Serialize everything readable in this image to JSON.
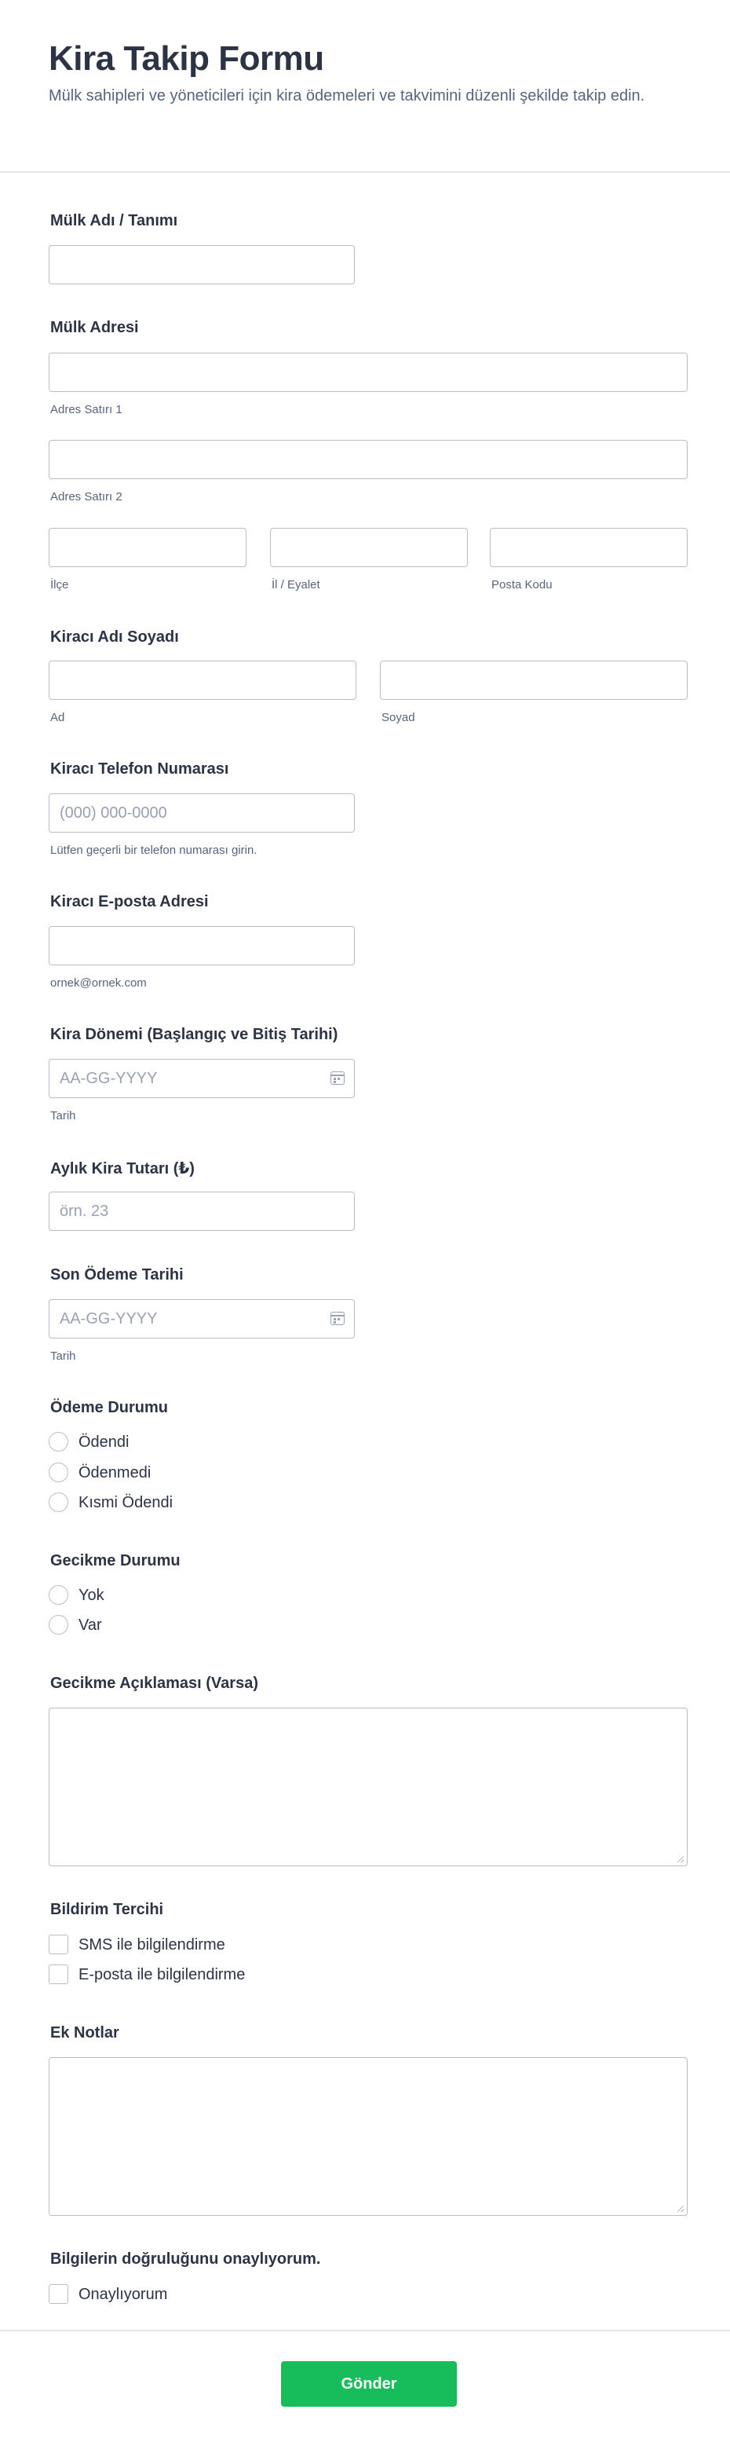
{
  "form": {
    "title": "Kira Takip Formu",
    "subtitle": "Mülk sahipleri ve yöneticileri için kira ödemeleri ve takvimini düzenli şekilde takip edin."
  },
  "fields": {
    "property_name": {
      "label": "Mülk Adı / Tanımı"
    },
    "property_address": {
      "label": "Mülk Adresi",
      "line1_sub": "Adres Satırı 1",
      "line2_sub": "Adres Satırı 2",
      "district_sub": "İlçe",
      "province_sub": "İl / Eyalet",
      "postal_sub": "Posta Kodu"
    },
    "tenant_name": {
      "label": "Kiracı Adı Soyadı",
      "first_sub": "Ad",
      "last_sub": "Soyad"
    },
    "tenant_phone": {
      "label": "Kiracı Telefon Numarası",
      "placeholder": "(000) 000-0000",
      "sub": "Lütfen geçerli bir telefon numarası girin."
    },
    "tenant_email": {
      "label": "Kiracı E-posta Adresi",
      "sub": "ornek@ornek.com"
    },
    "rent_period": {
      "label": "Kira Dönemi (Başlangıç ve Bitiş Tarihi)",
      "placeholder": "AA-GG-YYYY",
      "sub": "Tarih"
    },
    "monthly_rent": {
      "label": "Aylık Kira Tutarı (₺)",
      "placeholder": "örn. 23"
    },
    "due_date": {
      "label": "Son Ödeme Tarihi",
      "placeholder": "AA-GG-YYYY",
      "sub": "Tarih"
    },
    "payment_status": {
      "label": "Ödeme Durumu",
      "options": [
        "Ödendi",
        "Ödenmedi",
        "Kısmi Ödendi"
      ]
    },
    "late_status": {
      "label": "Gecikme Durumu",
      "options": [
        "Yok",
        "Var"
      ]
    },
    "late_explanation": {
      "label": "Gecikme Açıklaması (Varsa)"
    },
    "notification": {
      "label": "Bildirim Tercihi",
      "options": [
        "SMS ile bilgilendirme",
        "E-posta ile bilgilendirme"
      ]
    },
    "extra_notes": {
      "label": "Ek Notlar"
    },
    "confirm": {
      "label": "Bilgilerin doğruluğunu onaylıyorum.",
      "option": "Onaylıyorum"
    }
  },
  "submit": {
    "label": "Gönder"
  },
  "colors": {
    "accent": "#18bd5b",
    "text": "#2c3345",
    "muted": "#57647e",
    "border": "#b8bdc9"
  }
}
